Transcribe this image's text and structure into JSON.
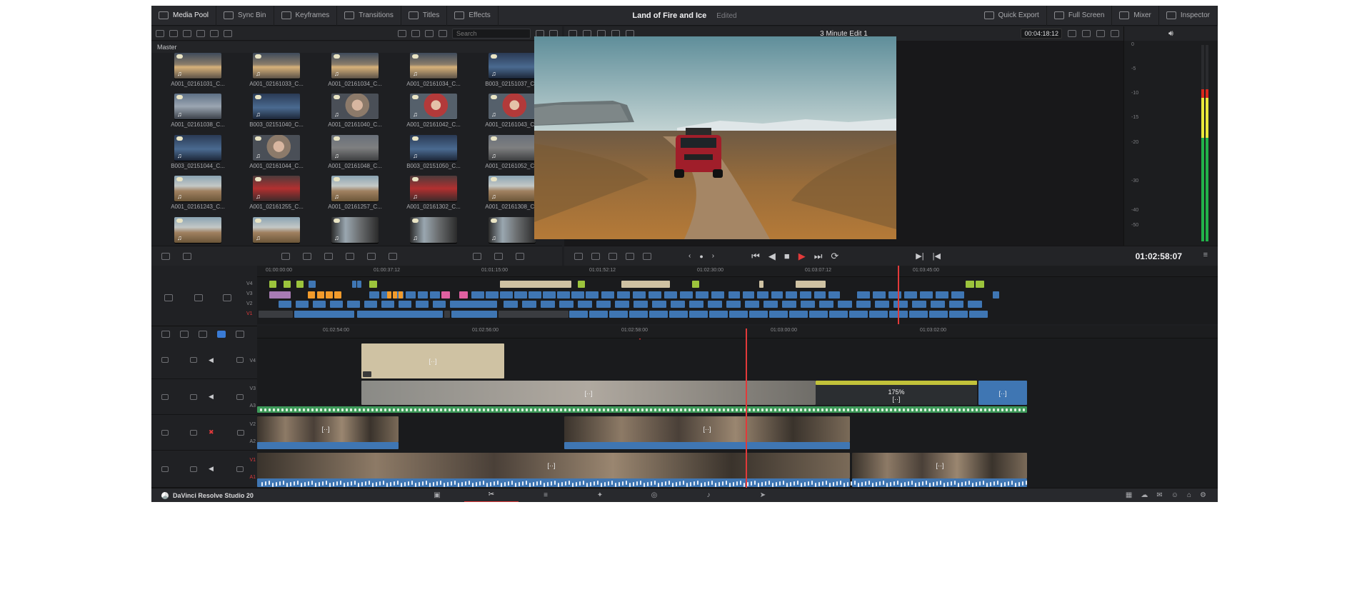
{
  "toolbar": {
    "left": [
      {
        "label": "Media Pool",
        "icon": "media-pool-icon",
        "active": true
      },
      {
        "label": "Sync Bin",
        "icon": "sync-bin-icon"
      },
      {
        "label": "Keyframes",
        "icon": "keyframes-icon"
      },
      {
        "label": "Transitions",
        "icon": "transitions-icon"
      },
      {
        "label": "Titles",
        "icon": "titles-icon"
      },
      {
        "label": "Effects",
        "icon": "effects-icon"
      }
    ],
    "project_title": "Land of Fire and Ice",
    "project_status": "Edited",
    "right": [
      {
        "label": "Quick Export",
        "icon": "quick-export-icon"
      },
      {
        "label": "Full Screen",
        "icon": "full-screen-icon"
      },
      {
        "label": "Mixer",
        "icon": "mixer-icon"
      },
      {
        "label": "Inspector",
        "icon": "inspector-icon"
      }
    ]
  },
  "media_pool": {
    "search_placeholder": "Search",
    "bin": "Master",
    "clips": [
      {
        "name": "A001_02161031_C...",
        "tone": "sunset"
      },
      {
        "name": "A001_02161033_C...",
        "tone": "sunset"
      },
      {
        "name": "A001_02161034_C...",
        "tone": "sunset"
      },
      {
        "name": "A001_02161034_C...",
        "tone": "sunset"
      },
      {
        "name": "B003_02151037_C...",
        "tone": "blue"
      },
      {
        "name": "A001_02161038_C...",
        "tone": "sky"
      },
      {
        "name": "B003_02151040_C...",
        "tone": "blue"
      },
      {
        "name": "A001_02161040_C...",
        "tone": "portrait"
      },
      {
        "name": "A001_02161042_C...",
        "tone": "portrait-red"
      },
      {
        "name": "A001_02161043_C...",
        "tone": "portrait-red"
      },
      {
        "name": "B003_02151044_C...",
        "tone": "blue"
      },
      {
        "name": "A001_02161044_C...",
        "tone": "portrait"
      },
      {
        "name": "A001_02161048_C...",
        "tone": "grey"
      },
      {
        "name": "B003_02151050_C...",
        "tone": "blue"
      },
      {
        "name": "A001_02161052_C...",
        "tone": "grey"
      },
      {
        "name": "A001_02161243_C...",
        "tone": "desert"
      },
      {
        "name": "A001_02161255_C...",
        "tone": "car-red"
      },
      {
        "name": "A001_02161257_C...",
        "tone": "desert"
      },
      {
        "name": "A001_02161302_C...",
        "tone": "car-red"
      },
      {
        "name": "A001_02161308_C...",
        "tone": "desert"
      },
      {
        "name": "",
        "tone": "desert"
      },
      {
        "name": "",
        "tone": "desert"
      },
      {
        "name": "",
        "tone": "interior"
      },
      {
        "name": "",
        "tone": "interior"
      },
      {
        "name": "",
        "tone": "interior"
      }
    ]
  },
  "viewer": {
    "timeline_name": "3 Minute Edit 1",
    "duration_timecode": "00:04:18:12",
    "current_timecode": "01:02:58:07"
  },
  "audio_meter": {
    "scale": [
      "0",
      "-5",
      "-10",
      "-15",
      "-20",
      "-30",
      "-40",
      "-50"
    ],
    "level_fraction": 0.88
  },
  "upper_timeline": {
    "ticks": [
      "01:00:00:00",
      "01:00:37:12",
      "01:01:15:00",
      "01:01:52:12",
      "01:02:30:00",
      "01:03:07:12",
      "01:03:45:00"
    ],
    "tracks": [
      "V4",
      "V3",
      "V2",
      "V1"
    ],
    "playhead_fraction": 0.53
  },
  "lower_timeline": {
    "ticks": [
      "01:02:54:00",
      "01:02:56:00",
      "01:02:58:00",
      "01:03:00:00",
      "01:03:02:00"
    ],
    "tracks": [
      {
        "video": "V4",
        "audio": ""
      },
      {
        "video": "V3",
        "audio": "A3"
      },
      {
        "video": "V2",
        "audio": "A2",
        "muted": true
      },
      {
        "video": "V1",
        "audio": "A1"
      }
    ],
    "speed_label": "175%",
    "playhead_fraction": 0.5
  },
  "pagebar": {
    "brand": "DaVinci Resolve Studio 20",
    "pages": [
      "media-icon",
      "cut-icon",
      "edit-icon",
      "fusion-icon",
      "color-icon",
      "fairlight-icon",
      "deliver-icon"
    ],
    "active_page": 1
  }
}
